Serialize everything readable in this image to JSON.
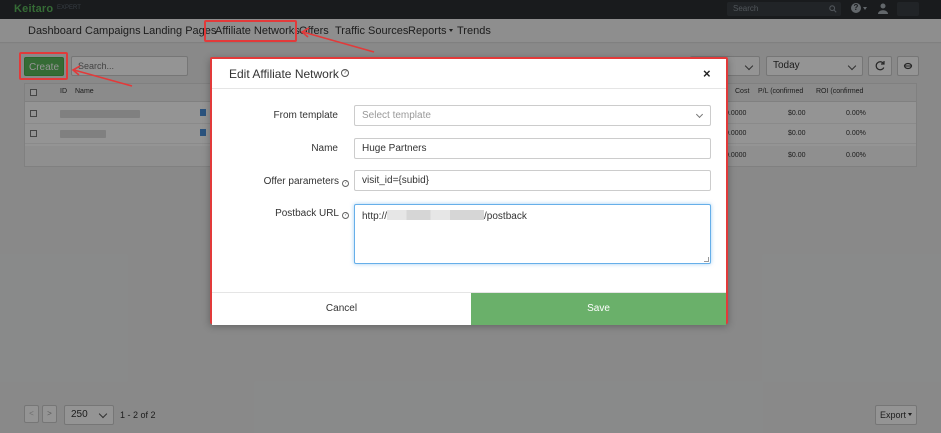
{
  "app": {
    "logo": "Keitaro",
    "logo_sub": "EXPERT"
  },
  "topbar": {
    "search_placeholder": "Search"
  },
  "nav": {
    "items": [
      {
        "label": "Dashboard"
      },
      {
        "label": "Campaigns"
      },
      {
        "label": "Landing Pages"
      },
      {
        "label": "Affiliate Networks"
      },
      {
        "label": "Offers"
      },
      {
        "label": "Traffic Sources"
      },
      {
        "label": "Reports"
      },
      {
        "label": "Trends"
      }
    ]
  },
  "toolbar": {
    "create_label": "Create",
    "search_placeholder": "Search...",
    "date_range": "Today"
  },
  "table": {
    "columns": {
      "id": "ID",
      "name": "Name",
      "cost": "Cost",
      "pl": "P/L (confirmed",
      "roi": "ROI (confirmed"
    },
    "rows": [
      {
        "cost": "0.0000",
        "pl": "$0.00",
        "roi": "0.00%"
      },
      {
        "cost": "0.0000",
        "pl": "$0.00",
        "roi": "0.00%"
      }
    ],
    "totals": {
      "cost": "0.0000",
      "pl": "$0.00",
      "roi": "0.00%"
    }
  },
  "pager": {
    "prev": "<",
    "next": ">",
    "per_page": "250",
    "range": "1 - 2 of 2",
    "export_label": "Export"
  },
  "modal": {
    "title": "Edit Affiliate Network",
    "close": "×",
    "fields": {
      "template_label": "From template",
      "template_placeholder": "Select template",
      "name_label": "Name",
      "name_value": "Huge Partners",
      "offer_params_label": "Offer parameters",
      "offer_params_value": "visit_id={subid}",
      "postback_label": "Postback URL",
      "postback_prefix": "http://",
      "postback_suffix": "/postback"
    },
    "cancel_label": "Cancel",
    "save_label": "Save"
  },
  "colors": {
    "accent_green": "#5cb85c",
    "save_green": "#6ab06a",
    "annotation_red": "#e23a3a",
    "topbar": "#2b2f33"
  }
}
